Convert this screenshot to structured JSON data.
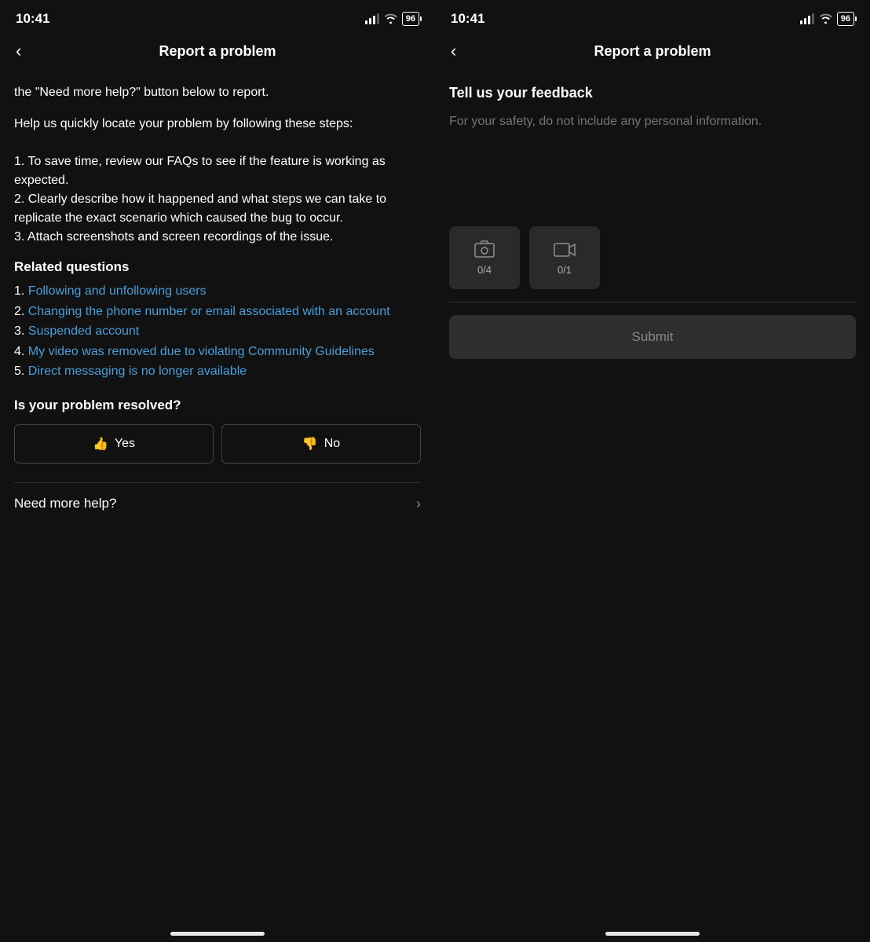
{
  "left": {
    "status": {
      "time": "10:41",
      "battery": "96"
    },
    "header": {
      "back_label": "‹",
      "title": "Report a problem"
    },
    "body_intro": "the \"Need more help?\" button below to report.",
    "help_section": {
      "intro": "Help us quickly locate your problem by following these steps:",
      "steps": [
        "1. To save time, review our FAQs to see if the feature is working as expected.",
        "2. Clearly describe how it happened and what steps we can take to replicate the exact scenario which caused the bug to occur.",
        "3. Attach screenshots and screen recordings of the issue."
      ]
    },
    "related": {
      "heading": "Related questions",
      "items": [
        {
          "num": "1.",
          "text": "Following and unfollowing users"
        },
        {
          "num": "2.",
          "text": "Changing the phone number or email associated with an account"
        },
        {
          "num": "3.",
          "text": "Suspended account"
        },
        {
          "num": "4.",
          "text": "My video was removed due to violating Community Guidelines"
        },
        {
          "num": "5.",
          "text": "Direct messaging is no longer available"
        }
      ]
    },
    "resolved": {
      "label": "Is your problem resolved?",
      "yes_label": "Yes",
      "no_label": "No",
      "yes_icon": "👍",
      "no_icon": "👎"
    },
    "more_help": {
      "text": "Need more help?",
      "chevron": "›"
    }
  },
  "right": {
    "status": {
      "time": "10:41",
      "battery": "96"
    },
    "header": {
      "back_label": "‹",
      "title": "Report a problem"
    },
    "feedback": {
      "title": "Tell us your feedback",
      "placeholder": "For your safety, do not include any personal information."
    },
    "media": {
      "photo_label": "0/4",
      "video_label": "0/1"
    },
    "submit_label": "Submit"
  }
}
